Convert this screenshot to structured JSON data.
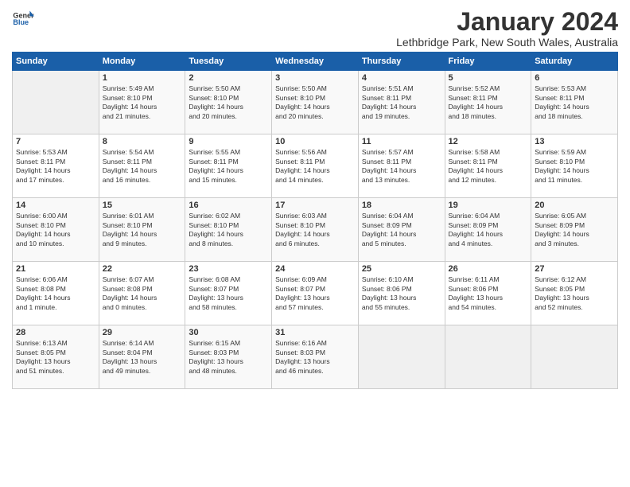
{
  "header": {
    "logo_general": "General",
    "logo_blue": "Blue",
    "month_title": "January 2024",
    "subtitle": "Lethbridge Park, New South Wales, Australia"
  },
  "days_of_week": [
    "Sunday",
    "Monday",
    "Tuesday",
    "Wednesday",
    "Thursday",
    "Friday",
    "Saturday"
  ],
  "weeks": [
    [
      {
        "day": "",
        "info": ""
      },
      {
        "day": "1",
        "info": "Sunrise: 5:49 AM\nSunset: 8:10 PM\nDaylight: 14 hours\nand 21 minutes."
      },
      {
        "day": "2",
        "info": "Sunrise: 5:50 AM\nSunset: 8:10 PM\nDaylight: 14 hours\nand 20 minutes."
      },
      {
        "day": "3",
        "info": "Sunrise: 5:50 AM\nSunset: 8:10 PM\nDaylight: 14 hours\nand 20 minutes."
      },
      {
        "day": "4",
        "info": "Sunrise: 5:51 AM\nSunset: 8:11 PM\nDaylight: 14 hours\nand 19 minutes."
      },
      {
        "day": "5",
        "info": "Sunrise: 5:52 AM\nSunset: 8:11 PM\nDaylight: 14 hours\nand 18 minutes."
      },
      {
        "day": "6",
        "info": "Sunrise: 5:53 AM\nSunset: 8:11 PM\nDaylight: 14 hours\nand 18 minutes."
      }
    ],
    [
      {
        "day": "7",
        "info": "Sunrise: 5:53 AM\nSunset: 8:11 PM\nDaylight: 14 hours\nand 17 minutes."
      },
      {
        "day": "8",
        "info": "Sunrise: 5:54 AM\nSunset: 8:11 PM\nDaylight: 14 hours\nand 16 minutes."
      },
      {
        "day": "9",
        "info": "Sunrise: 5:55 AM\nSunset: 8:11 PM\nDaylight: 14 hours\nand 15 minutes."
      },
      {
        "day": "10",
        "info": "Sunrise: 5:56 AM\nSunset: 8:11 PM\nDaylight: 14 hours\nand 14 minutes."
      },
      {
        "day": "11",
        "info": "Sunrise: 5:57 AM\nSunset: 8:11 PM\nDaylight: 14 hours\nand 13 minutes."
      },
      {
        "day": "12",
        "info": "Sunrise: 5:58 AM\nSunset: 8:11 PM\nDaylight: 14 hours\nand 12 minutes."
      },
      {
        "day": "13",
        "info": "Sunrise: 5:59 AM\nSunset: 8:10 PM\nDaylight: 14 hours\nand 11 minutes."
      }
    ],
    [
      {
        "day": "14",
        "info": "Sunrise: 6:00 AM\nSunset: 8:10 PM\nDaylight: 14 hours\nand 10 minutes."
      },
      {
        "day": "15",
        "info": "Sunrise: 6:01 AM\nSunset: 8:10 PM\nDaylight: 14 hours\nand 9 minutes."
      },
      {
        "day": "16",
        "info": "Sunrise: 6:02 AM\nSunset: 8:10 PM\nDaylight: 14 hours\nand 8 minutes."
      },
      {
        "day": "17",
        "info": "Sunrise: 6:03 AM\nSunset: 8:10 PM\nDaylight: 14 hours\nand 6 minutes."
      },
      {
        "day": "18",
        "info": "Sunrise: 6:04 AM\nSunset: 8:09 PM\nDaylight: 14 hours\nand 5 minutes."
      },
      {
        "day": "19",
        "info": "Sunrise: 6:04 AM\nSunset: 8:09 PM\nDaylight: 14 hours\nand 4 minutes."
      },
      {
        "day": "20",
        "info": "Sunrise: 6:05 AM\nSunset: 8:09 PM\nDaylight: 14 hours\nand 3 minutes."
      }
    ],
    [
      {
        "day": "21",
        "info": "Sunrise: 6:06 AM\nSunset: 8:08 PM\nDaylight: 14 hours\nand 1 minute."
      },
      {
        "day": "22",
        "info": "Sunrise: 6:07 AM\nSunset: 8:08 PM\nDaylight: 14 hours\nand 0 minutes."
      },
      {
        "day": "23",
        "info": "Sunrise: 6:08 AM\nSunset: 8:07 PM\nDaylight: 13 hours\nand 58 minutes."
      },
      {
        "day": "24",
        "info": "Sunrise: 6:09 AM\nSunset: 8:07 PM\nDaylight: 13 hours\nand 57 minutes."
      },
      {
        "day": "25",
        "info": "Sunrise: 6:10 AM\nSunset: 8:06 PM\nDaylight: 13 hours\nand 55 minutes."
      },
      {
        "day": "26",
        "info": "Sunrise: 6:11 AM\nSunset: 8:06 PM\nDaylight: 13 hours\nand 54 minutes."
      },
      {
        "day": "27",
        "info": "Sunrise: 6:12 AM\nSunset: 8:05 PM\nDaylight: 13 hours\nand 52 minutes."
      }
    ],
    [
      {
        "day": "28",
        "info": "Sunrise: 6:13 AM\nSunset: 8:05 PM\nDaylight: 13 hours\nand 51 minutes."
      },
      {
        "day": "29",
        "info": "Sunrise: 6:14 AM\nSunset: 8:04 PM\nDaylight: 13 hours\nand 49 minutes."
      },
      {
        "day": "30",
        "info": "Sunrise: 6:15 AM\nSunset: 8:03 PM\nDaylight: 13 hours\nand 48 minutes."
      },
      {
        "day": "31",
        "info": "Sunrise: 6:16 AM\nSunset: 8:03 PM\nDaylight: 13 hours\nand 46 minutes."
      },
      {
        "day": "",
        "info": ""
      },
      {
        "day": "",
        "info": ""
      },
      {
        "day": "",
        "info": ""
      }
    ]
  ]
}
